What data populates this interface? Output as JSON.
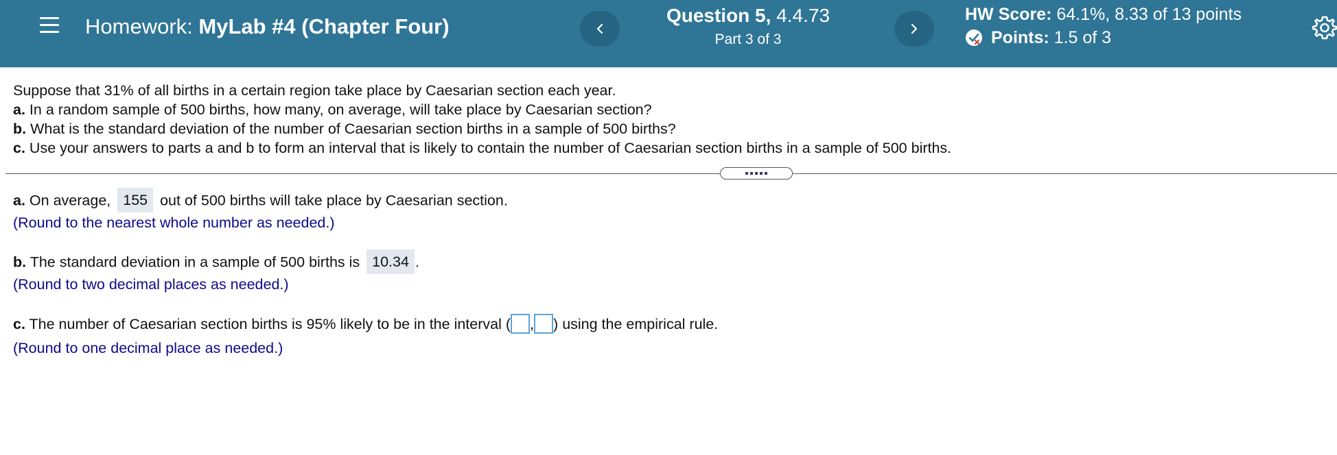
{
  "header": {
    "homework_prefix": "Homework:",
    "homework_name": "MyLab #4 (Chapter Four)",
    "question_label": "Question 5,",
    "question_id": "4.4.73",
    "part": "Part 3 of 3",
    "hw_score_label": "HW Score:",
    "hw_score_value": "64.1%, 8.33 of 13 points",
    "points_label": "Points:",
    "points_value": "1.5 of 3"
  },
  "problem": {
    "intro": "Suppose that 31% of all births in a certain region take place by Caesarian section each year.",
    "a_label": "a.",
    "a_text": "In a random sample of 500 births, how many, on average, will take place by Caesarian section?",
    "b_label": "b.",
    "b_text": "What is the standard deviation of the number of Caesarian section births in a sample of 500 births?",
    "c_label": "c.",
    "c_text": "Use your answers to parts a and b to form an interval that is likely to contain the number of Caesarian section births in a sample of 500 births."
  },
  "answers": {
    "a": {
      "label": "a.",
      "prefix": "On average,",
      "value": "155",
      "suffix": "out of 500 births will take place by Caesarian section.",
      "hint": "(Round to the nearest whole number as needed.)"
    },
    "b": {
      "label": "b.",
      "prefix": "The standard deviation in a sample of 500 births is",
      "value": "10.34",
      "suffix": ".",
      "hint": "(Round to two decimal places as needed.)"
    },
    "c": {
      "label": "c.",
      "prefix": "The number of Caesarian section births is 95% likely to be in the interval",
      "open_paren": "(",
      "lower_value": "",
      "comma": ",",
      "upper_value": "",
      "close_paren": ")",
      "suffix": "using the empirical rule.",
      "hint": "(Round to one decimal place as needed.)"
    }
  },
  "icons": {
    "menu": "hamburger-menu-icon",
    "prev": "chevron-left-icon",
    "next": "chevron-right-icon",
    "points": "partial-credit-icon",
    "settings": "gear-icon",
    "expand": "more-dots-icon"
  },
  "colors": {
    "header_bg": "#2f7596",
    "nav_button_bg": "#256581",
    "hint_text": "#0e0a8c",
    "filled_answer_bg": "#e3e8ef",
    "input_border": "#5aa2d8"
  }
}
